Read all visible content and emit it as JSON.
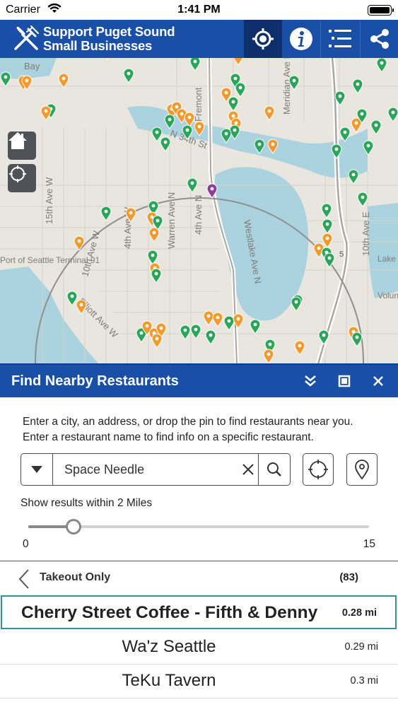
{
  "status_bar": {
    "carrier": "Carrier",
    "time": "1:41 PM"
  },
  "header": {
    "title_line1": "Support Puget Sound",
    "title_line2": "Small Businesses",
    "buttons": [
      "locate-icon",
      "info-icon",
      "list-icon",
      "share-icon"
    ]
  },
  "map": {
    "labels": {
      "bay": "Bay",
      "fremont": "Fremont",
      "meridian": "Meridian Ave N",
      "nw_street": "N 34th St",
      "fifteenth_w": "15th Ave W",
      "tenth_w": "10th Ave W",
      "fourth_w": "4th Ave W",
      "warren": "Warren Ave N",
      "fourth_n": "4th Ave N",
      "westlake": "Westlake Ave N",
      "tenth_e": "10th Ave E",
      "elliott": "Elliott Ave W",
      "port": "Port of Seattle Terminal 91",
      "lakeview": "Lake View Cemet",
      "volunteer": "Volunte Park",
      "hwy": "5"
    },
    "colors": {
      "green_pin": "#2aa55a",
      "orange_pin": "#f29a2e",
      "purple_pin": "#8e3c9e",
      "water": "#aad3df",
      "land": "#e9e6df"
    }
  },
  "panel": {
    "title": "Find Nearby Restaurants",
    "instructions": "Enter a city, an address, or drop the pin to find restaurants near you.  Enter a restaurant name to find info on a specific restaurant.",
    "search_value": "Space Needle",
    "range_label": "Show results within 2 Miles",
    "range": {
      "min_label": "0",
      "max_label": "15",
      "value": 2,
      "min": 0,
      "max": 15
    },
    "filter_label": "Takeout Only",
    "result_count": "(83)",
    "results": [
      {
        "name": "Cherry Street Coffee - Fifth & Denny",
        "distance": "0.28 mi",
        "selected": true
      },
      {
        "name": "Wa'z Seattle",
        "distance": "0.29 mi",
        "selected": false
      },
      {
        "name": "TeKu Tavern",
        "distance": "0.3 mi",
        "selected": false
      }
    ]
  }
}
